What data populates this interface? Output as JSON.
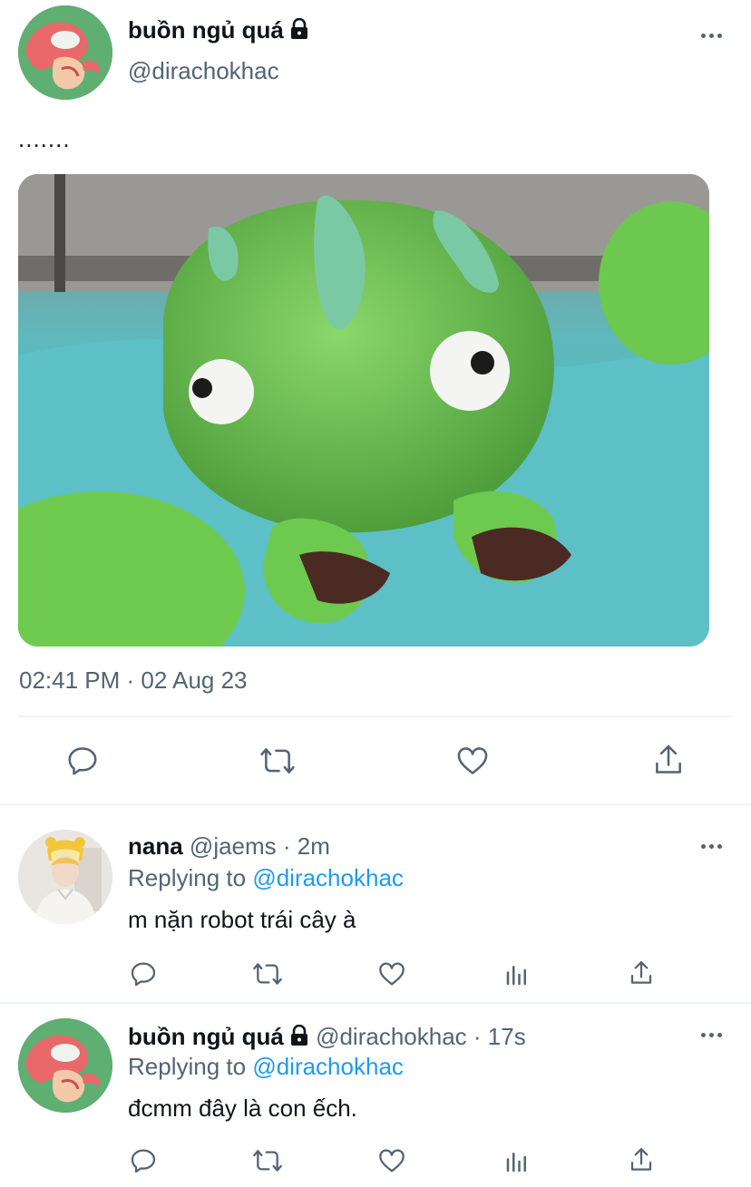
{
  "main_tweet": {
    "display_name": "buồn ngủ quá",
    "handle": "@dirachokhac",
    "text": ".......",
    "timestamp": "02:41 PM · 02 Aug 23",
    "image_alt": "green frosted frog cupcake on blue icing",
    "actions": [
      "reply-icon",
      "retweet-icon",
      "like-icon",
      "share-icon"
    ]
  },
  "replies": [
    {
      "display_name": "nana",
      "handle": "@jaems",
      "time": "· 2m",
      "replying_prefix": "Replying to",
      "replying_handle": "@dirachokhac",
      "text": "m nặn robot trái cây à"
    },
    {
      "display_name": "buồn ngủ quá",
      "handle": "@dirachokhac",
      "time": "· 17s",
      "replying_prefix": "Replying to",
      "replying_handle": "@dirachokhac",
      "text": "đcmm đây là con ếch."
    }
  ],
  "colors": {
    "link": "#1d9bf0",
    "muted": "#536471",
    "text": "#0f1419"
  }
}
